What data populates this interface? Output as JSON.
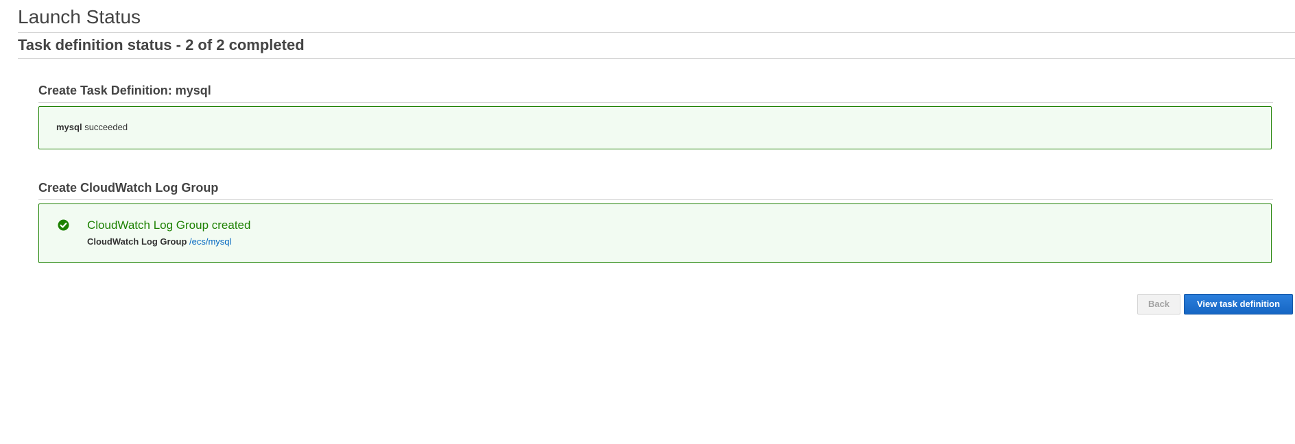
{
  "page": {
    "title": "Launch Status",
    "subtitle": "Task definition status - 2 of 2 completed"
  },
  "sections": [
    {
      "heading": "Create Task Definition: mysql",
      "status": {
        "name": "mysql",
        "result": "succeeded"
      }
    },
    {
      "heading": "Create CloudWatch Log Group",
      "status": {
        "icon": "check-circle-icon",
        "title": "CloudWatch Log Group created",
        "detail_label": "CloudWatch Log Group",
        "detail_link": "/ecs/mysql"
      }
    }
  ],
  "actions": {
    "back_label": "Back",
    "primary_label": "View task definition"
  },
  "colors": {
    "success": "#1d8102",
    "success_bg": "#f2fbf2",
    "link": "#0066c0",
    "primary_button": "#1666c4"
  }
}
